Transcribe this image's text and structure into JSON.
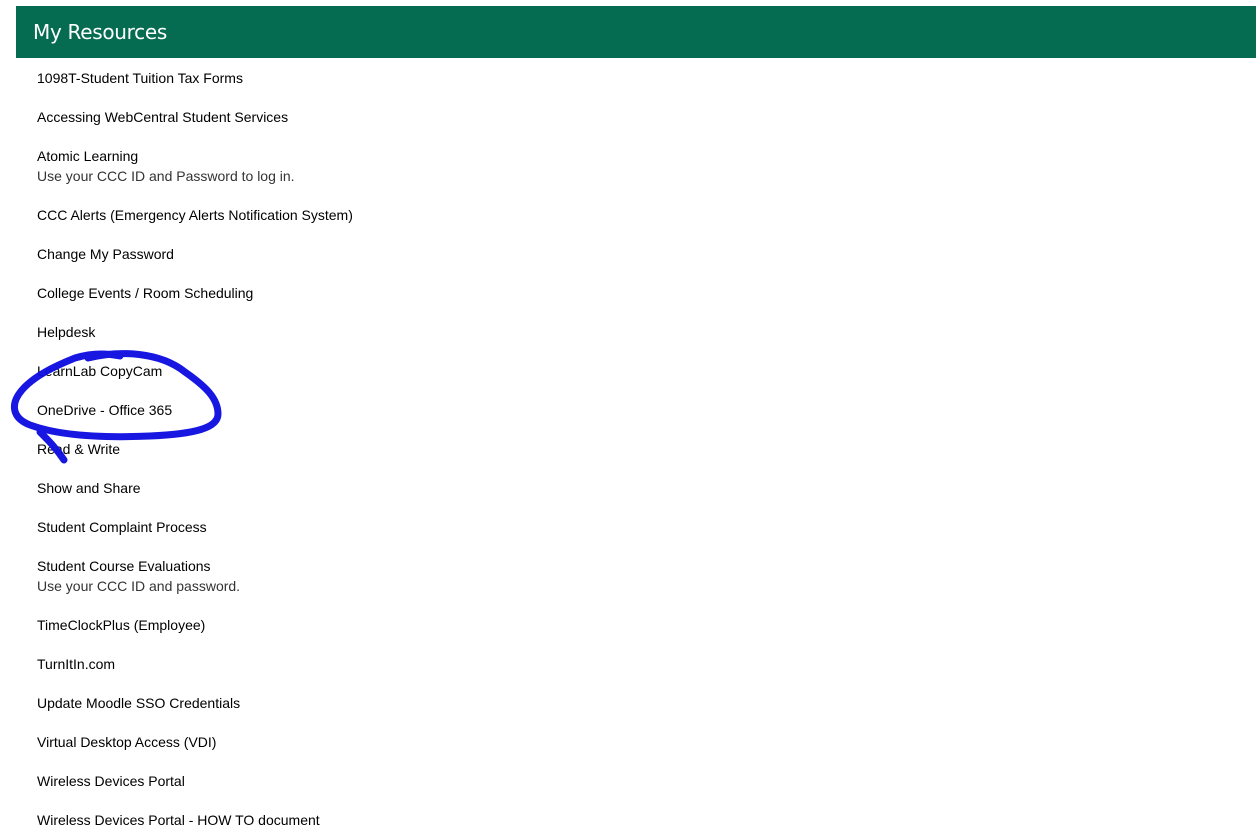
{
  "header": {
    "title": "My Resources",
    "background_color": "#056c51"
  },
  "resources": [
    {
      "label": "1098T-Student Tuition Tax Forms",
      "description": ""
    },
    {
      "label": "Accessing WebCentral Student Services",
      "description": ""
    },
    {
      "label": "Atomic Learning",
      "description": "Use your CCC ID and Password to log in."
    },
    {
      "label": "CCC Alerts (Emergency Alerts Notification System)",
      "description": ""
    },
    {
      "label": "Change My Password",
      "description": ""
    },
    {
      "label": "College Events / Room Scheduling",
      "description": ""
    },
    {
      "label": "Helpdesk",
      "description": ""
    },
    {
      "label": "LearnLab CopyCam",
      "description": ""
    },
    {
      "label": "OneDrive - Office 365",
      "description": ""
    },
    {
      "label": "Read & Write",
      "description": ""
    },
    {
      "label": "Show and Share",
      "description": ""
    },
    {
      "label": "Student Complaint Process",
      "description": ""
    },
    {
      "label": "Student Course Evaluations",
      "description": "Use your CCC ID and password."
    },
    {
      "label": "TimeClockPlus (Employee)",
      "description": ""
    },
    {
      "label": "TurnItIn.com",
      "description": ""
    },
    {
      "label": "Update Moodle SSO Credentials",
      "description": ""
    },
    {
      "label": "Virtual Desktop Access (VDI)",
      "description": ""
    },
    {
      "label": "Wireless Devices Portal",
      "description": ""
    },
    {
      "label": "Wireless Devices Portal - HOW TO document",
      "description": ""
    }
  ],
  "annotation": {
    "color": "#1010e0",
    "circled_item": "OneDrive - Office 365"
  }
}
